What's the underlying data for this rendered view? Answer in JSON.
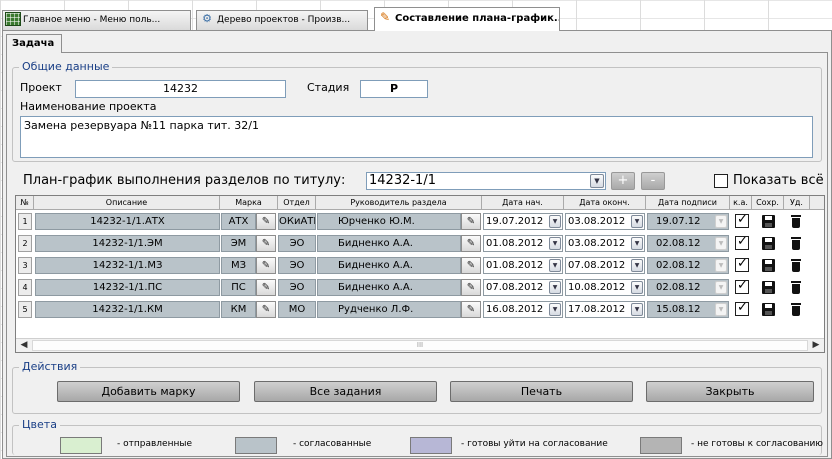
{
  "window_tabs": [
    {
      "label": "Главное меню - Меню поль...",
      "icon": "grid-icon",
      "active": false
    },
    {
      "label": "Дерево проектов - Произв...",
      "icon": "tree-icon",
      "active": false
    },
    {
      "label": "Составление плана-график...",
      "icon": "pencil-icon",
      "active": true
    }
  ],
  "form": {
    "tab_label": "Задача",
    "general": {
      "legend": "Общие данные",
      "project_label": "Проект",
      "project_value": "14232",
      "stage_label": "Стадия",
      "stage_value": "Р",
      "name_label": "Наименование проекта",
      "name_value": "Замена резервуара №11 парка тит. 32/1"
    },
    "plan": {
      "title": "План-график выполнения разделов по титулу:",
      "title_value": "14232-1/1",
      "add_symbol": "+",
      "remove_symbol": "-",
      "show_all_label": "Показать всё",
      "show_all_checked": false
    },
    "table": {
      "columns": [
        "№",
        "Описание",
        "Марка",
        "Отдел",
        "Руководитель раздела",
        "Дата нач.",
        "Дата оконч.",
        "Дата подписи",
        "к.а.",
        "Сохр.",
        "Уд."
      ],
      "rows": [
        {
          "n": "1",
          "desc": "14232-1/1.АТХ",
          "mark": "АТХ",
          "dept": "ОКиАТП",
          "head": "Юрченко Ю.М.",
          "start": "19.07.2012",
          "end": "03.08.2012",
          "sign": "19.07.12",
          "ka": true
        },
        {
          "n": "2",
          "desc": "14232-1/1.ЭМ",
          "mark": "ЭМ",
          "dept": "ЭО",
          "head": "Бидненко А.А.",
          "start": "01.08.2012",
          "end": "03.08.2012",
          "sign": "02.08.12",
          "ka": true
        },
        {
          "n": "3",
          "desc": "14232-1/1.МЗ",
          "mark": "МЗ",
          "dept": "ЭО",
          "head": "Бидненко А.А.",
          "start": "01.08.2012",
          "end": "07.08.2012",
          "sign": "02.08.12",
          "ka": true
        },
        {
          "n": "4",
          "desc": "14232-1/1.ПС",
          "mark": "ПС",
          "dept": "ЭО",
          "head": "Бидненко А.А.",
          "start": "07.08.2012",
          "end": "10.08.2012",
          "sign": "02.08.12",
          "ka": true
        },
        {
          "n": "5",
          "desc": "14232-1/1.КМ",
          "mark": "КМ",
          "dept": "МО",
          "head": "Рудченко Л.Ф.",
          "start": "16.08.2012",
          "end": "17.08.2012",
          "sign": "15.08.12",
          "ka": true
        }
      ],
      "scroll_marker": "III"
    },
    "actions": {
      "legend": "Действия",
      "buttons": [
        "Добавить марку",
        "Все задания",
        "Печать",
        "Закрыть"
      ]
    },
    "colors": {
      "legend": "Цвета",
      "items": [
        {
          "label": "- отправленные",
          "color": "#d9efd0"
        },
        {
          "label": "- согласованные",
          "color": "#b9c3c9"
        },
        {
          "label": "- готовы уйти на согласование",
          "color": "#b7b7d6"
        },
        {
          "label": "- не готовы к согласованию",
          "color": "#b4b4b4"
        }
      ]
    }
  }
}
